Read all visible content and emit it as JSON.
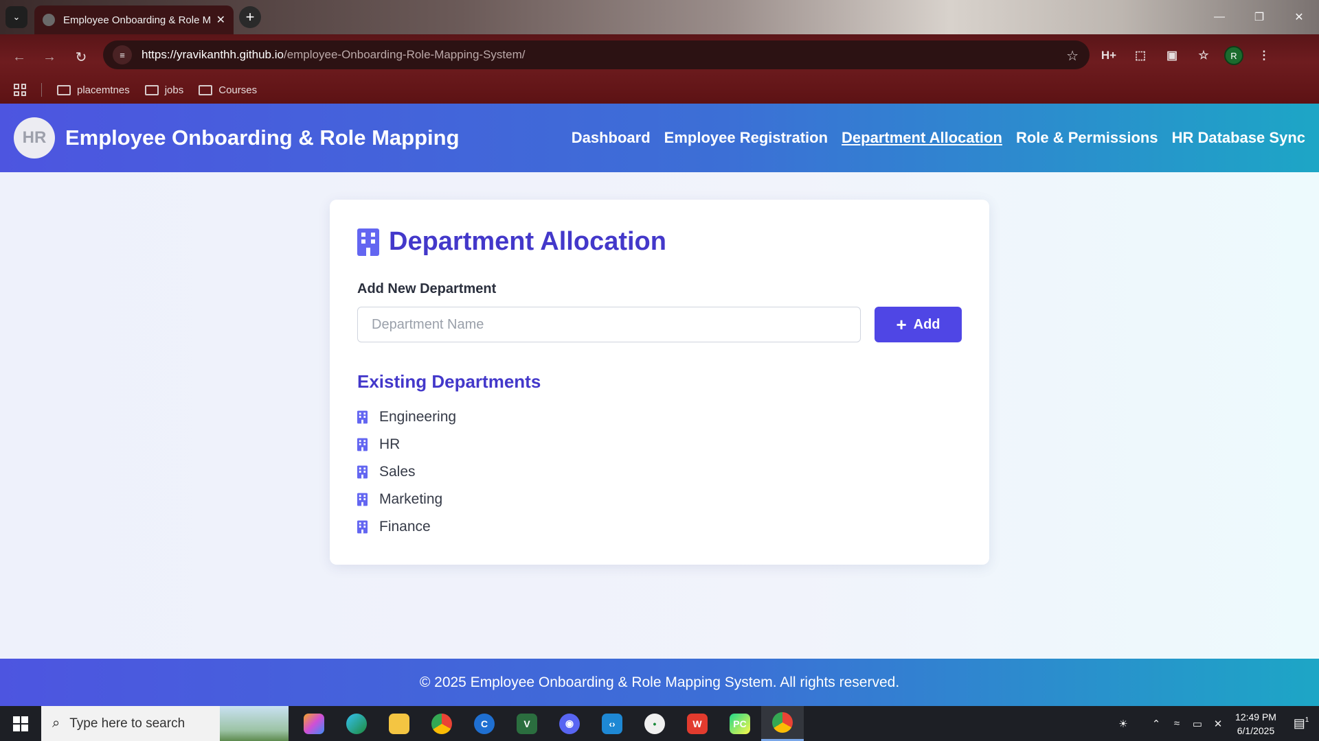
{
  "browser": {
    "tab_title": "Employee Onboarding & Role M",
    "url_host": "https://yravikanthh.github.io",
    "url_path": "/employee-Onboarding-Role-Mapping-System/",
    "profile_initial": "R",
    "bookmarks": [
      "placemtnes",
      "jobs",
      "Courses"
    ]
  },
  "site": {
    "logo_text": "HR",
    "title": "Employee Onboarding & Role Mapping",
    "nav": [
      {
        "label": "Dashboard",
        "active": false
      },
      {
        "label": "Employee Registration",
        "active": false
      },
      {
        "label": "Department Allocation",
        "active": true
      },
      {
        "label": "Role & Permissions",
        "active": false
      },
      {
        "label": "HR Database Sync",
        "active": false
      }
    ],
    "footer": "© 2025 Employee Onboarding & Role Mapping System. All rights reserved."
  },
  "card": {
    "heading": "Department Allocation",
    "add_label": "Add New Department",
    "input_placeholder": "Department Name",
    "input_value": "",
    "add_button": "Add",
    "existing_heading": "Existing Departments",
    "departments": [
      "Engineering",
      "HR",
      "Sales",
      "Marketing",
      "Finance"
    ]
  },
  "taskbar": {
    "search_placeholder": "Type here to search",
    "time": "12:49 PM",
    "date": "6/1/2025",
    "notification_count": "1"
  },
  "colors": {
    "accent": "#4f46e5",
    "heading": "#4338ca",
    "header_gradient_start": "#4d55e0",
    "header_gradient_end": "#1da6c6"
  }
}
